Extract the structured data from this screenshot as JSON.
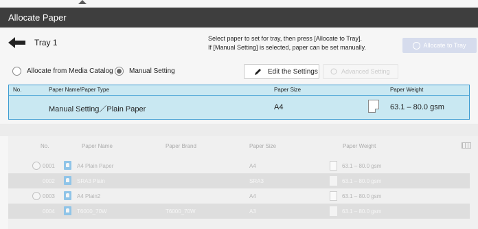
{
  "window": {
    "title": "Allocate Paper"
  },
  "header": {
    "tray_label": "Tray 1",
    "instruction_line1": "Select paper to set for tray, then press [Allocate to Tray].",
    "instruction_line2": "If [Manual Setting] is selected, paper can be set manually.",
    "allocate_button_label": "Allocate to Tray"
  },
  "options": {
    "from_catalog_label": "Allocate from Media Catalog",
    "manual_setting_label": "Manual Setting",
    "edit_button_label": "Edit the Settings",
    "advanced_button_label": "Advanced Setting"
  },
  "selected": {
    "headers": {
      "no": "No.",
      "name": "Paper Name/Paper Type",
      "size": "Paper Size",
      "weight": "Paper Weight"
    },
    "name": "Manual Setting／Plain Paper",
    "size": "A4",
    "weight": "63.1 – 80.0 gsm"
  },
  "catalog": {
    "headers": {
      "no": "No.",
      "name": "Paper Name",
      "brand": "Paper Brand",
      "size": "Paper Size",
      "weight": "Paper Weight"
    },
    "rows": [
      {
        "no": "0001",
        "name": "A4 Plain Paper",
        "brand": "",
        "size": "A4",
        "weight": "63.1 – 80.0 gsm"
      },
      {
        "no": "0002",
        "name": "SRA3 Plain",
        "brand": "",
        "size": "SRA3",
        "weight": "63.1 – 80.0 gsm"
      },
      {
        "no": "0003",
        "name": "A4 Plain2",
        "brand": "",
        "size": "A4",
        "weight": "63.1 – 80.0 gsm"
      },
      {
        "no": "0004",
        "name": "T6000_70W",
        "brand": "T6000_70W",
        "size": "A3",
        "weight": "63.1 – 80.0 gsm"
      }
    ]
  }
}
